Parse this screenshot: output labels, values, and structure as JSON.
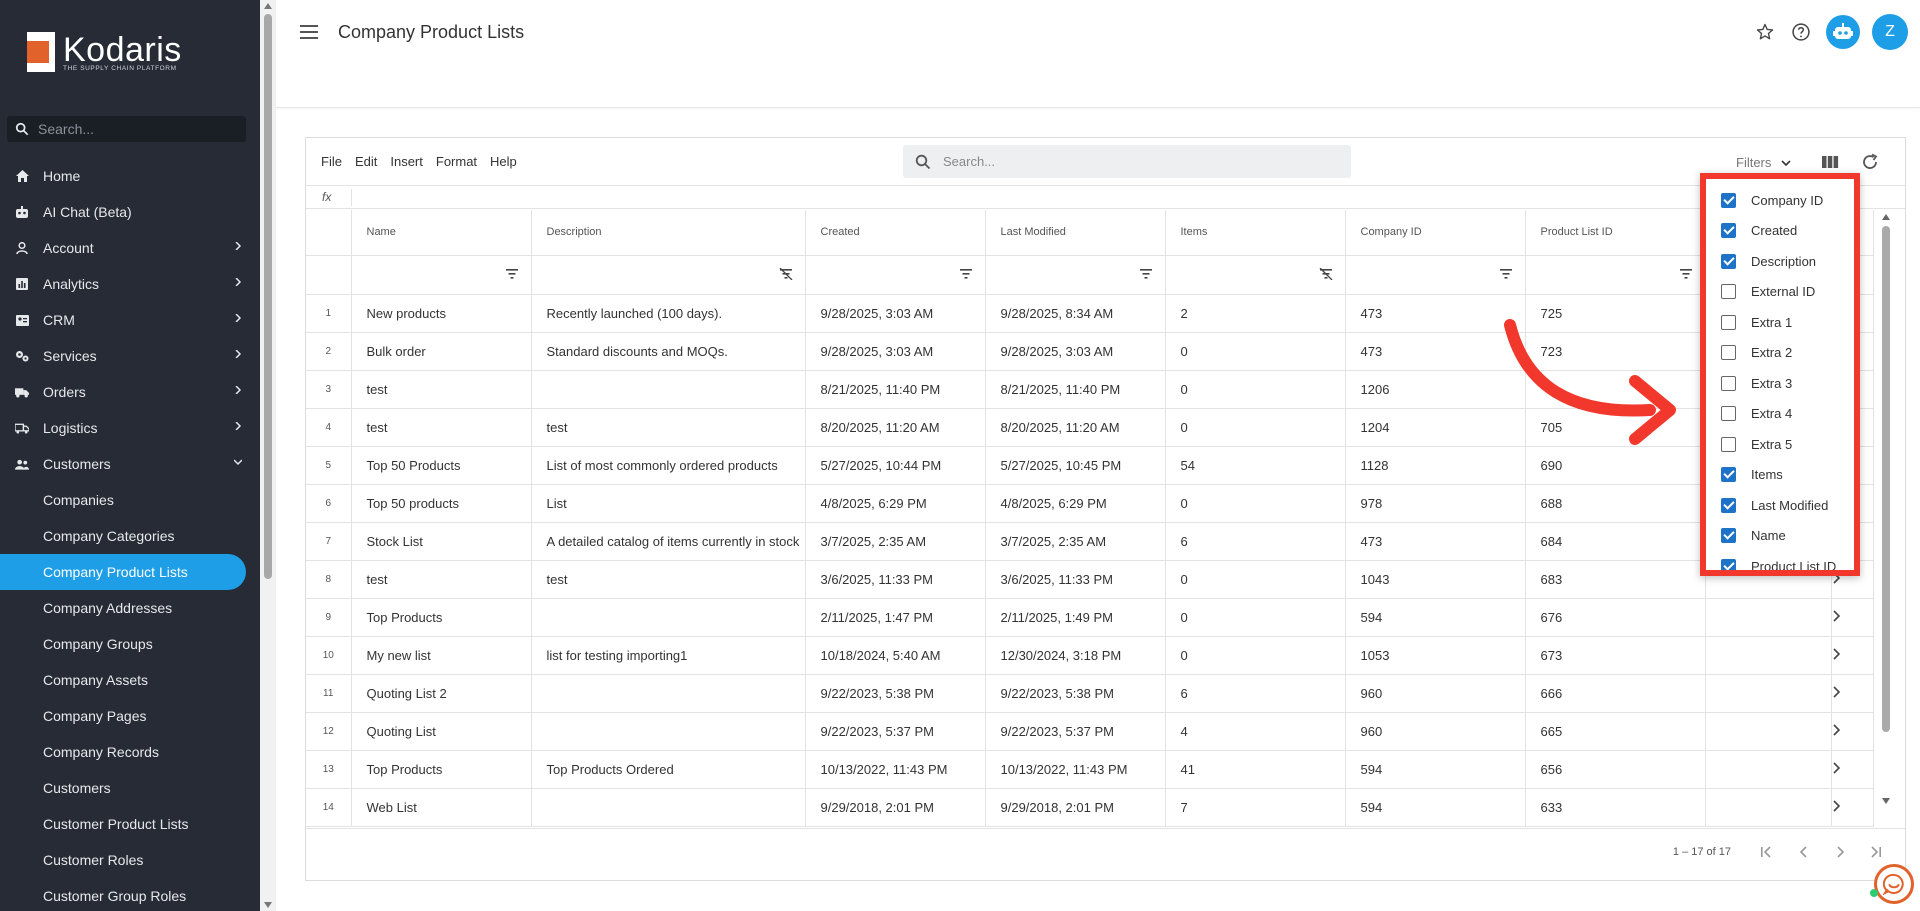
{
  "brand": {
    "name": "Kodaris",
    "tagline": "THE SUPPLY CHAIN PLATFORM",
    "accent": "#1e9ee6",
    "logo_orange": "#e1622a"
  },
  "sidebar": {
    "search_placeholder": "Search...",
    "items": [
      {
        "label": "Home",
        "icon": "home-icon",
        "expandable": false
      },
      {
        "label": "AI Chat (Beta)",
        "icon": "robot-icon",
        "expandable": false
      },
      {
        "label": "Account",
        "icon": "person-icon",
        "expandable": true
      },
      {
        "label": "Analytics",
        "icon": "chart-icon",
        "expandable": true
      },
      {
        "label": "CRM",
        "icon": "contact-card-icon",
        "expandable": true
      },
      {
        "label": "Services",
        "icon": "gears-icon",
        "expandable": true
      },
      {
        "label": "Orders",
        "icon": "truck-icon",
        "expandable": true
      },
      {
        "label": "Logistics",
        "icon": "delivery-icon",
        "expandable": true
      },
      {
        "label": "Customers",
        "icon": "group-icon",
        "expandable": true,
        "expanded": true
      }
    ],
    "sub_items": [
      "Companies",
      "Company Categories",
      "Company Product Lists",
      "Company Addresses",
      "Company Groups",
      "Company Assets",
      "Company Pages",
      "Company Records",
      "Customers",
      "Customer Product Lists",
      "Customer Roles",
      "Customer Group Roles"
    ],
    "active_sub": "Company Product Lists"
  },
  "header": {
    "title": "Company Product Lists",
    "avatar_initial": "Z"
  },
  "grid": {
    "menus": [
      "File",
      "Edit",
      "Insert",
      "Format",
      "Help"
    ],
    "search_placeholder": "Search...",
    "filters_label": "Filters",
    "fx_label": "fx",
    "columns": [
      "Name",
      "Description",
      "Created",
      "Last Modified",
      "Items",
      "Company ID",
      "Product List ID"
    ],
    "rows": [
      [
        "1",
        "New products",
        "Recently launched (100 days).",
        "9/28/2025, 3:03 AM",
        "9/28/2025, 8:34 AM",
        "2",
        "473",
        "725"
      ],
      [
        "2",
        "Bulk order",
        "Standard discounts and MOQs.",
        "9/28/2025, 3:03 AM",
        "9/28/2025, 3:03 AM",
        "0",
        "473",
        "723"
      ],
      [
        "3",
        "test",
        "",
        "8/21/2025, 11:40 PM",
        "8/21/2025, 11:40 PM",
        "0",
        "1206",
        ""
      ],
      [
        "4",
        "test",
        "test",
        "8/20/2025, 11:20 AM",
        "8/20/2025, 11:20 AM",
        "0",
        "1204",
        "705"
      ],
      [
        "5",
        "Top 50 Products",
        "List of most commonly ordered products",
        "5/27/2025, 10:44 PM",
        "5/27/2025, 10:45 PM",
        "54",
        "1128",
        "690"
      ],
      [
        "6",
        "Top 50 products",
        "List",
        "4/8/2025, 6:29 PM",
        "4/8/2025, 6:29 PM",
        "0",
        "978",
        "688"
      ],
      [
        "7",
        "Stock List",
        "A detailed catalog of items currently in stock",
        "3/7/2025, 2:35 AM",
        "3/7/2025, 2:35 AM",
        "6",
        "473",
        "684"
      ],
      [
        "8",
        "test",
        "test",
        "3/6/2025, 11:33 PM",
        "3/6/2025, 11:33 PM",
        "0",
        "1043",
        "683"
      ],
      [
        "9",
        "Top Products",
        "",
        "2/11/2025, 1:47 PM",
        "2/11/2025, 1:49 PM",
        "0",
        "594",
        "676"
      ],
      [
        "10",
        "My new list",
        "list for testing importing1",
        "10/18/2024, 5:40 AM",
        "12/30/2024, 3:18 PM",
        "0",
        "1053",
        "673"
      ],
      [
        "11",
        "Quoting List 2",
        "",
        "9/22/2023, 5:38 PM",
        "9/22/2023, 5:38 PM",
        "6",
        "960",
        "666"
      ],
      [
        "12",
        "Quoting List",
        "",
        "9/22/2023, 5:37 PM",
        "9/22/2023, 5:37 PM",
        "4",
        "960",
        "665"
      ],
      [
        "13",
        "Top Products",
        "Top Products Ordered",
        "10/13/2022, 11:43 PM",
        "10/13/2022, 11:43 PM",
        "41",
        "594",
        "656"
      ],
      [
        "14",
        "Web List",
        "",
        "9/29/2018, 2:01 PM",
        "9/29/2018, 2:01 PM",
        "7",
        "594",
        "633"
      ]
    ],
    "pager": "1 – 17 of 17"
  },
  "column_chooser": {
    "options": [
      {
        "label": "Company ID",
        "checked": true
      },
      {
        "label": "Created",
        "checked": true
      },
      {
        "label": "Description",
        "checked": true
      },
      {
        "label": "External ID",
        "checked": false
      },
      {
        "label": "Extra 1",
        "checked": false
      },
      {
        "label": "Extra 2",
        "checked": false
      },
      {
        "label": "Extra 3",
        "checked": false
      },
      {
        "label": "Extra 4",
        "checked": false
      },
      {
        "label": "Extra 5",
        "checked": false
      },
      {
        "label": "Items",
        "checked": true
      },
      {
        "label": "Last Modified",
        "checked": true
      },
      {
        "label": "Name",
        "checked": true
      },
      {
        "label": "Product List ID",
        "checked": true
      }
    ],
    "highlight_color": "#f2382c"
  }
}
